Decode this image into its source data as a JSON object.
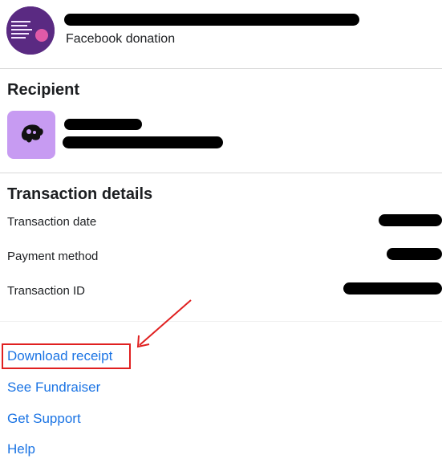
{
  "header": {
    "subtitle": "Facebook donation",
    "name_redacted": true
  },
  "recipient": {
    "heading": "Recipient",
    "name_redacted": true
  },
  "transaction": {
    "heading": "Transaction details",
    "rows": [
      {
        "label": "Transaction date",
        "value_redacted": true
      },
      {
        "label": "Payment method",
        "value_redacted": true
      },
      {
        "label": "Transaction ID",
        "value_redacted": true
      }
    ]
  },
  "links": {
    "download_receipt": "Download receipt",
    "see_fundraiser": "See Fundraiser",
    "get_support": "Get Support",
    "help": "Help"
  },
  "annotation": {
    "highlight_color": "#e02020",
    "target": "download_receipt"
  },
  "colors": {
    "link": "#1b74e4",
    "recipient_avatar_bg": "#c79bf2",
    "fundraiser_avatar_bg": "#5a2a82"
  }
}
